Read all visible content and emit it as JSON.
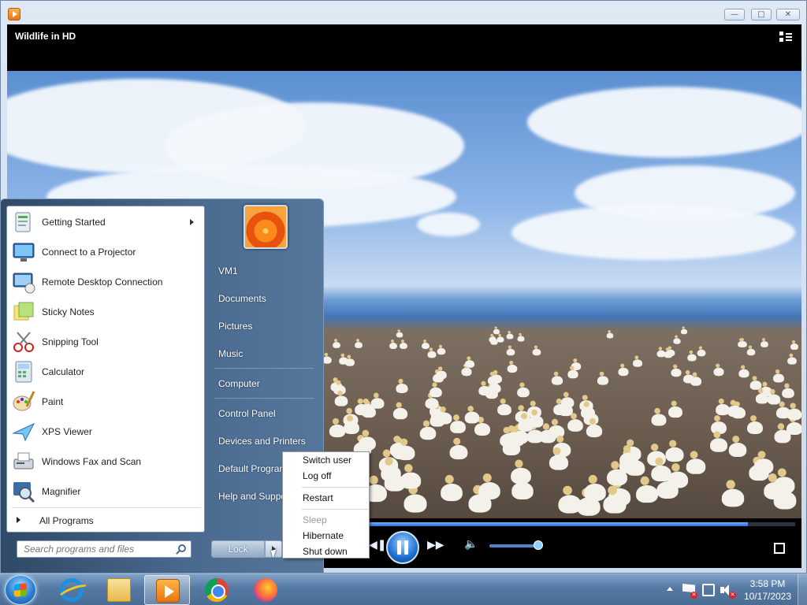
{
  "player": {
    "title": "Wildlife in HD",
    "seek_progress": 0.94,
    "volume_level": 0.88
  },
  "window_controls": {
    "minimize_icon": "minimize-icon",
    "maximize_icon": "maximize-icon",
    "close_icon": "close-icon"
  },
  "start_menu": {
    "programs": [
      {
        "label": "Getting Started",
        "icon": "getting-started-icon",
        "has_submenu": true
      },
      {
        "label": "Connect to a Projector",
        "icon": "projector-icon"
      },
      {
        "label": "Remote Desktop Connection",
        "icon": "remote-desktop-icon"
      },
      {
        "label": "Sticky Notes",
        "icon": "sticky-notes-icon"
      },
      {
        "label": "Snipping Tool",
        "icon": "snipping-tool-icon"
      },
      {
        "label": "Calculator",
        "icon": "calculator-icon"
      },
      {
        "label": "Paint",
        "icon": "paint-icon"
      },
      {
        "label": "XPS Viewer",
        "icon": "xps-viewer-icon"
      },
      {
        "label": "Windows Fax and Scan",
        "icon": "fax-scan-icon"
      },
      {
        "label": "Magnifier",
        "icon": "magnifier-icon"
      }
    ],
    "all_programs": "All Programs",
    "search_placeholder": "Search programs and files",
    "right_links": [
      "VM1",
      "Documents",
      "Pictures",
      "Music",
      "Computer",
      "Control Panel",
      "Devices and Printers",
      "Default Programs",
      "Help and Support"
    ],
    "lock_label": "Lock"
  },
  "power_menu": {
    "items": [
      "Switch user",
      "Log off",
      "Restart",
      "Sleep",
      "Hibernate",
      "Shut down"
    ]
  },
  "taskbar": {
    "apps": [
      "Internet Explorer",
      "Windows Explorer",
      "Windows Media Player",
      "Google Chrome",
      "Firefox"
    ],
    "time": "3:58 PM",
    "date": "10/17/2023"
  },
  "colors": {
    "accent": "#2a6fd1",
    "taskbar": "#5579a3",
    "start_menu": "#4b6a8f"
  }
}
